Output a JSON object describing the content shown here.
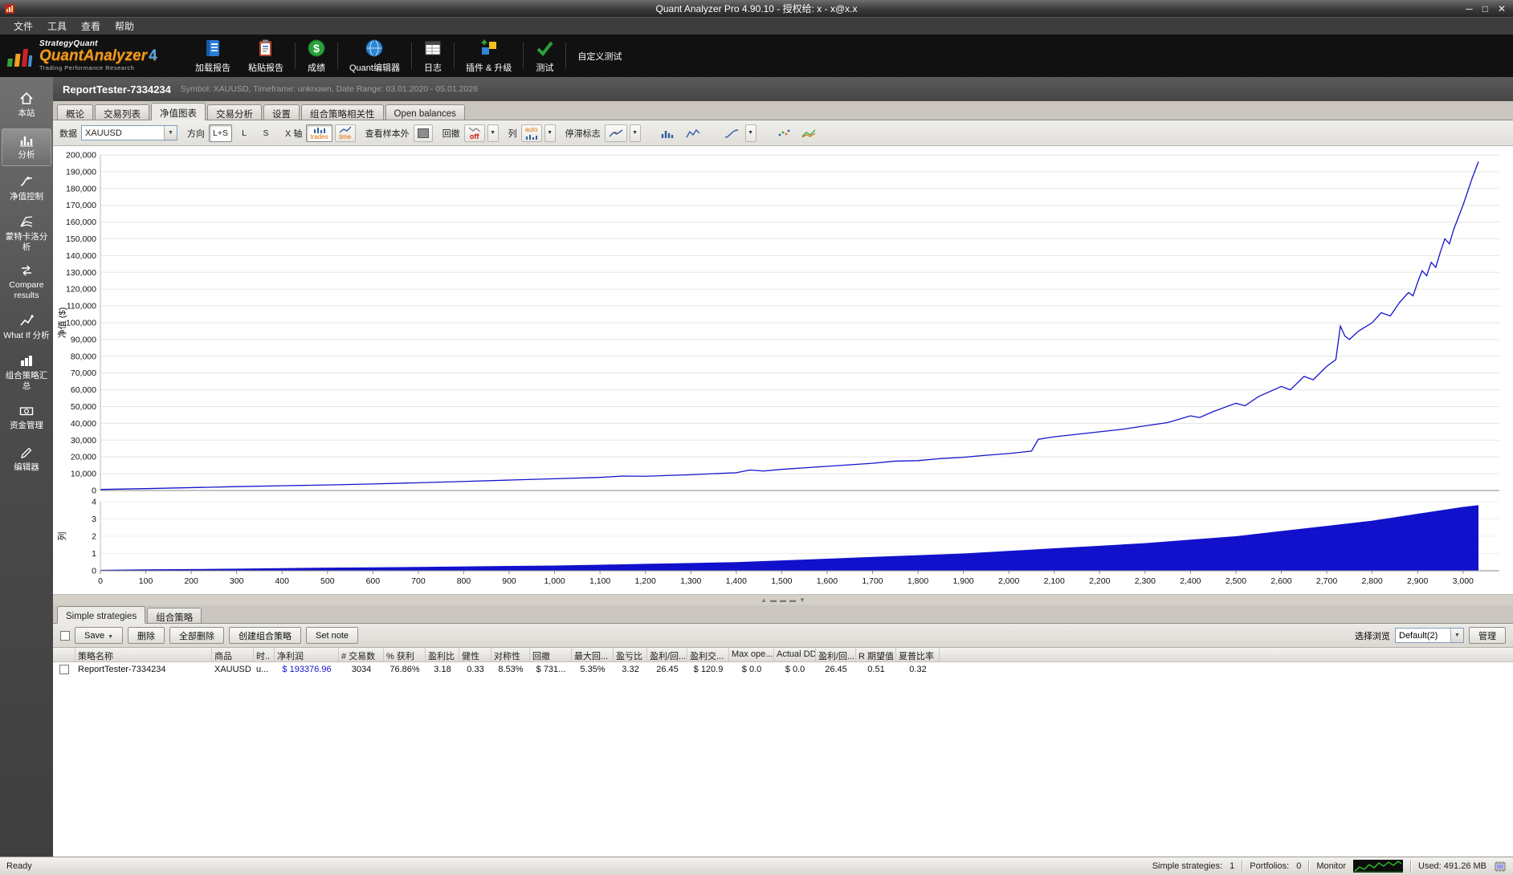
{
  "window": {
    "title": "Quant Analyzer Pro 4.90.10 - 授权给: x - x@x.x"
  },
  "menu": {
    "items": [
      {
        "label": "文件"
      },
      {
        "label": "工具"
      },
      {
        "label": "查看"
      },
      {
        "label": "帮助"
      }
    ]
  },
  "toolbar": {
    "brand": {
      "top": "StrategyQuant",
      "main": "QuantAnalyzer",
      "version": "4",
      "sub": "Trading Performance  Research"
    },
    "buttons": [
      {
        "label": "加载报告"
      },
      {
        "label": "粘贴报告"
      },
      {
        "label": "成绩"
      },
      {
        "label": "Quant编辑器"
      },
      {
        "label": "日志"
      },
      {
        "label": "插件 & 升级"
      },
      {
        "label": "测试"
      },
      {
        "label": "自定义测试"
      }
    ]
  },
  "sidebar": {
    "items": [
      {
        "label": "本站"
      },
      {
        "label": "分析"
      },
      {
        "label": "净值控制"
      },
      {
        "label": "蒙特卡洛分析"
      },
      {
        "label": "Compare results"
      },
      {
        "label": "What If 分析"
      },
      {
        "label": "组合策略汇总"
      },
      {
        "label": "资金管理"
      },
      {
        "label": "编辑器"
      }
    ]
  },
  "report": {
    "title": "ReportTester-7334234",
    "subtitle": "Symbol: XAUUSD, Timeframe: unknown, Date Range: 03.01.2020 - 05.01.2026"
  },
  "tabs": [
    {
      "label": "概论"
    },
    {
      "label": "交易列表"
    },
    {
      "label": "净值图表"
    },
    {
      "label": "交易分析"
    },
    {
      "label": "设置"
    },
    {
      "label": "组合策略相关性"
    },
    {
      "label": "Open balances"
    }
  ],
  "chart_toolbar": {
    "data_label": "数据",
    "data_value": "XAUUSD",
    "direction_label": "方向",
    "direction_options": [
      "L+S",
      "L",
      "S"
    ],
    "xaxis_label": "X 轴",
    "xaxis_options": [
      "trades",
      "time"
    ],
    "oos_label": "查看样本外",
    "drawdown_label": "回撤",
    "drawdown_value": "off",
    "columns_label": "列",
    "columns_value": "auto",
    "stagnation_label": "停滞标志"
  },
  "chart_data": [
    {
      "type": "line",
      "name": "equity",
      "title": "",
      "xlabel": "",
      "ylabel": "净值 ($)",
      "ylim": [
        0,
        200000
      ],
      "xlim": [
        0,
        3034
      ],
      "y_tick_step": 10000,
      "x_tick_step": 100,
      "grid": true,
      "color": "#1414cc",
      "x": [
        0,
        100,
        200,
        300,
        400,
        500,
        600,
        700,
        800,
        900,
        1000,
        1100,
        1150,
        1200,
        1300,
        1400,
        1430,
        1460,
        1500,
        1550,
        1600,
        1700,
        1750,
        1800,
        1850,
        1900,
        1950,
        2000,
        2050,
        2065,
        2100,
        2150,
        2200,
        2250,
        2300,
        2350,
        2400,
        2420,
        2450,
        2500,
        2520,
        2550,
        2600,
        2620,
        2650,
        2670,
        2700,
        2720,
        2730,
        2740,
        2750,
        2770,
        2800,
        2820,
        2840,
        2860,
        2880,
        2890,
        2900,
        2910,
        2920,
        2930,
        2940,
        2950,
        2960,
        2970,
        2980,
        2990,
        3000,
        3010,
        3020,
        3034
      ],
      "y": [
        600,
        1100,
        1700,
        2300,
        2800,
        3300,
        3900,
        4600,
        5400,
        6200,
        7000,
        7800,
        8600,
        8500,
        9400,
        10600,
        12200,
        11600,
        12600,
        13500,
        14400,
        16200,
        17500,
        17800,
        19000,
        19800,
        21000,
        22000,
        23500,
        30500,
        32000,
        33500,
        35000,
        36500,
        38500,
        40500,
        44500,
        43500,
        47000,
        52000,
        50500,
        56000,
        62000,
        60000,
        68000,
        66000,
        74000,
        78000,
        98000,
        92000,
        90000,
        95000,
        100000,
        106000,
        104000,
        112000,
        118000,
        116000,
        124000,
        131000,
        128000,
        136000,
        133000,
        142000,
        150000,
        147000,
        156000,
        163000,
        170000,
        178000,
        186000,
        196000
      ]
    },
    {
      "type": "bar",
      "name": "columns",
      "title": "",
      "xlabel": "",
      "ylabel": "列",
      "ylim": [
        0,
        4
      ],
      "xlim": [
        0,
        3034
      ],
      "color": "#1111cc",
      "x": [
        0,
        100,
        200,
        300,
        400,
        500,
        600,
        700,
        800,
        900,
        1000,
        1100,
        1200,
        1300,
        1400,
        1500,
        1600,
        1700,
        1800,
        1900,
        2000,
        2100,
        2200,
        2300,
        2400,
        2500,
        2600,
        2700,
        2750,
        2800,
        2850,
        2900,
        2950,
        3000,
        3034
      ],
      "values": [
        0.05,
        0.08,
        0.1,
        0.12,
        0.15,
        0.18,
        0.2,
        0.22,
        0.25,
        0.28,
        0.3,
        0.35,
        0.4,
        0.45,
        0.5,
        0.6,
        0.7,
        0.8,
        0.9,
        1.0,
        1.15,
        1.3,
        1.45,
        1.6,
        1.8,
        2.0,
        2.3,
        2.6,
        2.75,
        2.9,
        3.1,
        3.3,
        3.5,
        3.7,
        3.8
      ]
    }
  ],
  "bottom": {
    "tabs": [
      {
        "label": "Simple strategies"
      },
      {
        "label": "组合策略"
      }
    ],
    "buttons": {
      "save": "Save",
      "delete": "删除",
      "delete_all": "全部删除",
      "create_portfolio": "创建组合策略",
      "set_note": "Set note",
      "manage": "管理"
    },
    "view_label": "选择浏览",
    "view_value": "Default(2)",
    "table": {
      "columns": [
        "策略名称",
        "商品",
        "时..",
        "净利润",
        "# 交易数",
        "% 获利",
        "盈利比",
        "健性",
        "对称性",
        "回撤",
        "最大回...",
        "盈亏比",
        "盈利/回...",
        "盈利交...",
        "Max ope...",
        "Actual DD",
        "盈利/回...",
        "R 期望值",
        "夏普比率"
      ],
      "rows": [
        {
          "cells": [
            "ReportTester-7334234",
            "XAUUSD",
            "u...",
            "$ 193376.96",
            "3034",
            "76.86%",
            "3.18",
            "0.33",
            "8.53%",
            "$ 731...",
            "5.35%",
            "3.32",
            "26.45",
            "$ 120.9",
            "$ 0.0",
            "$ 0.0",
            "26.45",
            "0.51",
            "0.32"
          ]
        }
      ]
    }
  },
  "status": {
    "ready": "Ready",
    "simple_strategies_label": "Simple strategies:",
    "simple_strategies_value": "1",
    "portfolios_label": "Portfolios:",
    "portfolios_value": "0",
    "monitor_label": "Monitor",
    "memory": "Used: 491.26 MB"
  }
}
